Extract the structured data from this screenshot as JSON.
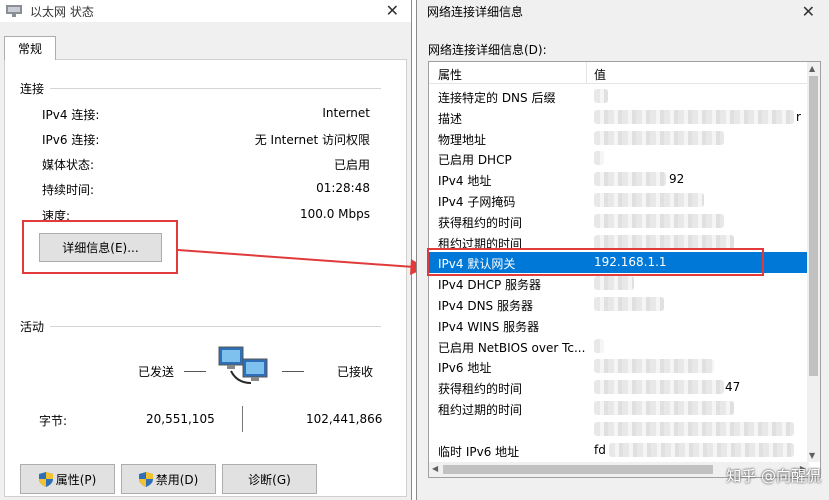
{
  "left": {
    "title": "以太网 状态",
    "close_glyph": "✕",
    "tab": "常规",
    "connection_group": "连接",
    "rows": [
      {
        "label": "IPv4 连接:",
        "value": "Internet"
      },
      {
        "label": "IPv6 连接:",
        "value": "无 Internet 访问权限"
      },
      {
        "label": "媒体状态:",
        "value": "已启用"
      },
      {
        "label": "持续时间:",
        "value": "01:28:48"
      },
      {
        "label": "速度:",
        "value": "100.0 Mbps"
      }
    ],
    "details_button": "详细信息(E)...",
    "activity_group": "活动",
    "sent_label": "已发送",
    "received_label": "已接收",
    "bytes_label": "字节:",
    "bytes_sent": "20,551,105",
    "bytes_received": "102,441,866",
    "properties_button": "属性(P)",
    "disable_button": "禁用(D)",
    "diagnose_button": "诊断(G)",
    "highlight_color": "#e03a3a"
  },
  "right": {
    "title": "网络连接详细信息",
    "close_glyph": "✕",
    "list_label": "网络连接详细信息(D):",
    "col_property": "属性",
    "col_value": "值",
    "rows": [
      {
        "p": "连接特定的 DNS 后缀",
        "v": ""
      },
      {
        "p": "描述",
        "v": "r"
      },
      {
        "p": "物理地址",
        "v": ""
      },
      {
        "p": "已启用 DHCP",
        "v": ""
      },
      {
        "p": "IPv4 地址",
        "v": "92"
      },
      {
        "p": "IPv4 子网掩码",
        "v": ""
      },
      {
        "p": "获得租约的时间",
        "v": ""
      },
      {
        "p": "租约过期的时间",
        "v": ""
      },
      {
        "p": "IPv4 默认网关",
        "v": "192.168.1.1"
      },
      {
        "p": "IPv4 DHCP 服务器",
        "v": ""
      },
      {
        "p": "IPv4 DNS 服务器",
        "v": ""
      },
      {
        "p": "IPv4 WINS 服务器",
        "v": ""
      },
      {
        "p": "已启用 NetBIOS over Tc...",
        "v": ""
      },
      {
        "p": "IPv6 地址",
        "v": ""
      },
      {
        "p": "获得租约的时间",
        "v": "47"
      },
      {
        "p": "租约过期的时间",
        "v": ""
      },
      {
        "p": "",
        "v": ""
      },
      {
        "p": "临时 IPv6 地址",
        "v": "fd"
      }
    ],
    "selected_index": 8,
    "selection_color": "#0078d7",
    "watermark": "知乎 @向醒侃"
  }
}
